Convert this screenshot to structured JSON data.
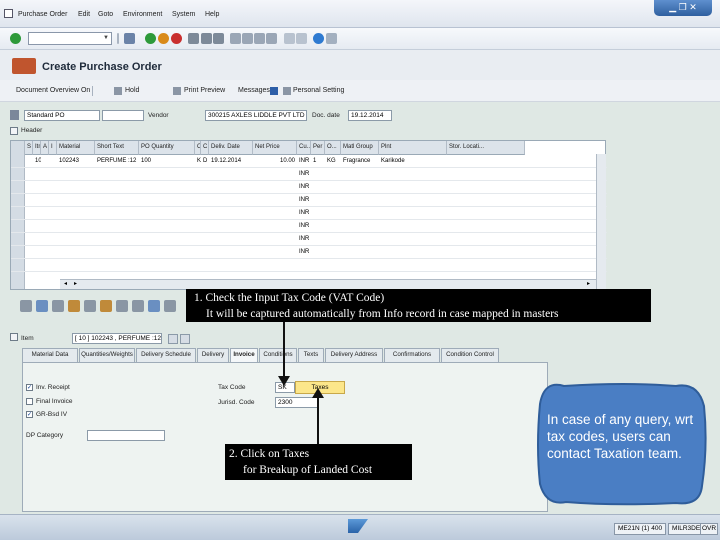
{
  "menu": {
    "items": [
      "Purchase Order",
      "Edit",
      "Goto",
      "Environment",
      "System",
      "Help"
    ]
  },
  "toolbar": {
    "command_placeholder": ""
  },
  "title": "Create Purchase Order",
  "app_toolbar": {
    "buttons": [
      "Document Overview On",
      "Hold",
      "Print Preview",
      "Messages",
      "Personal Setting"
    ]
  },
  "header": {
    "po_type": "Standard PO",
    "vendor_label": "Vendor",
    "vendor_value": "300215 AXLES LIDDLE PVT LTD",
    "doc_date_label": "Doc. date",
    "doc_date_value": "19.12.2014",
    "header_label": "Header"
  },
  "item_table": {
    "columns": [
      "S",
      "Itm",
      "A",
      "I",
      "Material",
      "Short Text",
      "PO Quantity",
      "O...",
      "C",
      "Deliv. Date",
      "Net Price",
      "Cu...",
      "Per",
      "O...",
      "Matl Group",
      "Plnt",
      "Stor. Locati..."
    ],
    "first_row": [
      "10",
      "102243",
      "PERFUME :12",
      "100",
      "KG",
      "D",
      "19.12.2014",
      "10.00",
      "INR",
      "1",
      "KG",
      "Fragrance",
      "Karikode"
    ],
    "currency_empty_rows": [
      "INR",
      "INR",
      "INR",
      "INR",
      "INR",
      "INR",
      "INR"
    ]
  },
  "item_detail": {
    "item_label": "Item",
    "item_value": "[ 10 ] 102243 , PERFUME :12",
    "tabs": [
      "Material Data",
      "Quantities/Weights",
      "Delivery Schedule",
      "Delivery",
      "Invoice",
      "Conditions",
      "Texts",
      "Delivery Address",
      "Confirmations",
      "Condition Control"
    ],
    "inv_receipt": "Inv. Receipt",
    "final_invoice": "Final Invoice",
    "gr_based_iv": "GR-Bsd IV",
    "dp_category": "DP Category",
    "tax_code_label": "Tax Code",
    "tax_code_value": "SK",
    "taxes_button": "Taxes",
    "jurisd_code_label": "Jurisd. Code",
    "jurisd_code_value": "2300"
  },
  "callouts": {
    "callout1_line1": "1. Check the Input Tax Code (VAT Code)",
    "callout1_line2": "It will be captured  automatically from Info record in case mapped in masters",
    "callout2_line1": "2. Click on Taxes",
    "callout2_line2": "for Breakup of Landed Cost",
    "bubble": "In case of any query, wrt tax codes, users can contact Taxation team."
  },
  "statusbar": {
    "session": "ME21N (1) 400",
    "server": "MILR3DEV3",
    "mode": "OVR"
  },
  "colors": {
    "bubble_fill": "#4a7ec4",
    "bubble_stroke": "#2f5d9a",
    "taxes_button": "#fce68a"
  }
}
